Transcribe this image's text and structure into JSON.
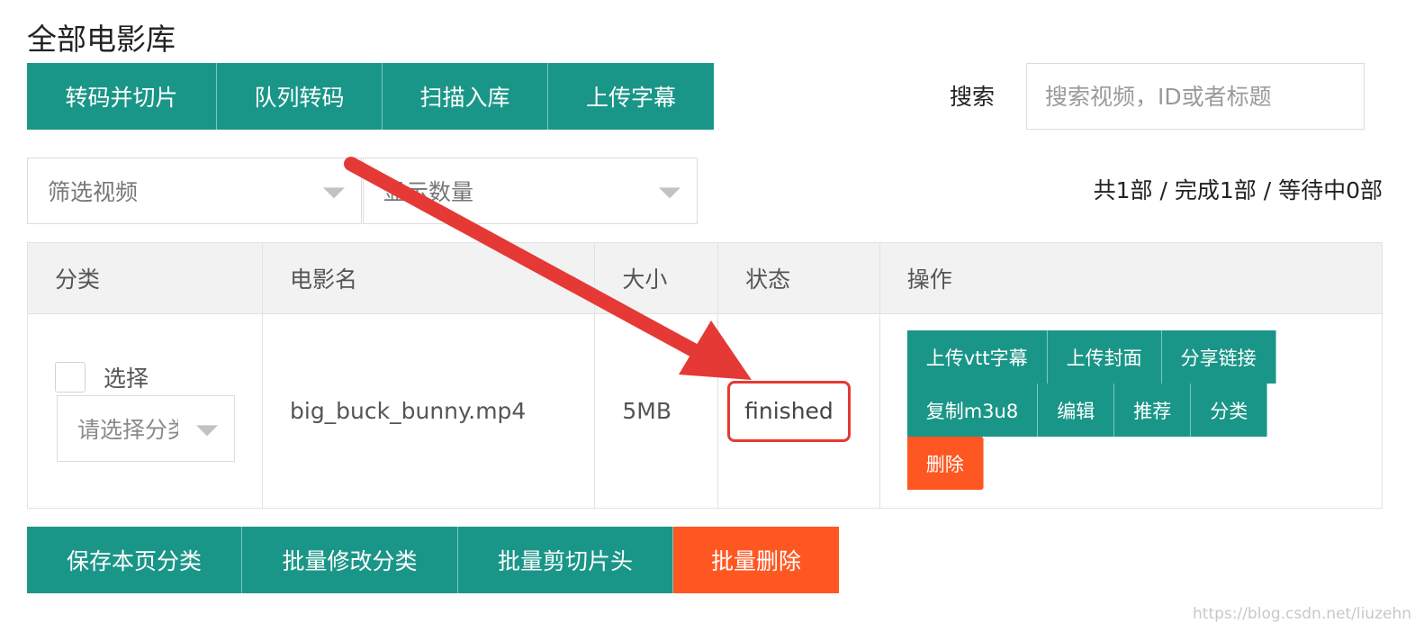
{
  "page_title": "全部电影库",
  "toolbar": {
    "transcode_slice": "转码并切片",
    "queue_transcode": "队列转码",
    "scan_import": "扫描入库",
    "upload_subtitle": "上传字幕"
  },
  "search": {
    "label": "搜索",
    "placeholder": "搜索视频，ID或者标题"
  },
  "filters": {
    "video": "筛选视频",
    "count": "显示数量"
  },
  "summary": "共1部 / 完成1部 / 等待中0部",
  "table": {
    "headers": [
      "分类",
      "电影名",
      "大小",
      "状态",
      "操作"
    ],
    "rows": [
      {
        "select_label": "选择",
        "category_placeholder": "请选择分类",
        "name": "big_buck_bunny.mp4",
        "size": "5MB",
        "status": "finished",
        "actions": [
          "上传vtt字幕",
          "上传封面",
          "分享链接",
          "复制m3u8",
          "编辑",
          "推荐",
          "分类",
          "删除"
        ]
      }
    ]
  },
  "bottom": {
    "save_category": "保存本页分类",
    "batch_edit_category": "批量修改分类",
    "batch_trim_head": "批量剪切片头",
    "batch_delete": "批量删除"
  },
  "colors": {
    "primary": "#1a9688",
    "danger": "#ff5722",
    "annotation": "#e53935"
  },
  "watermark": "https://blog.csdn.net/liuzehn"
}
